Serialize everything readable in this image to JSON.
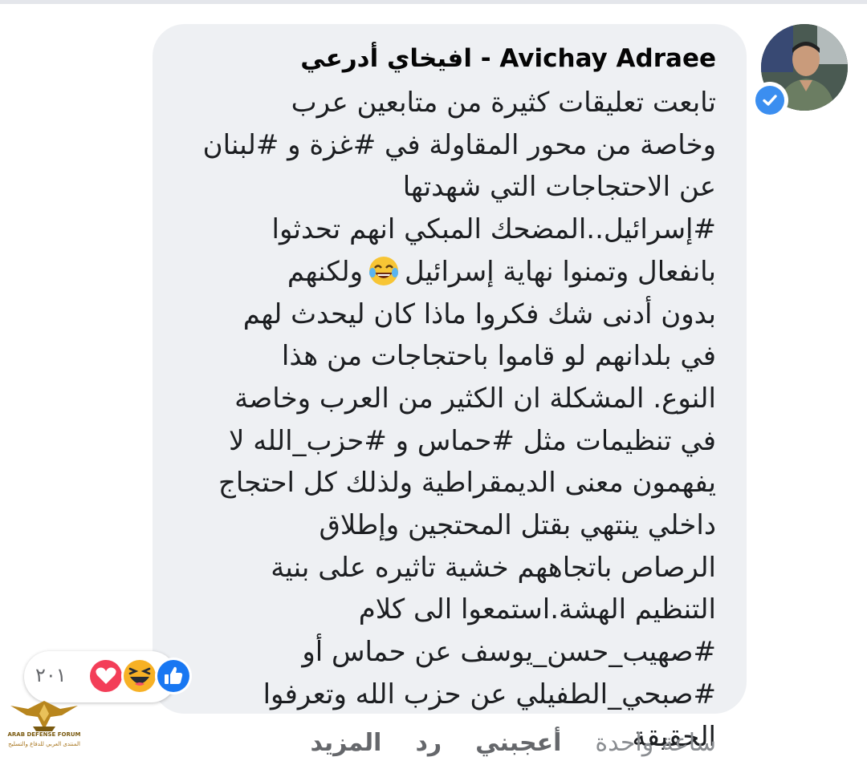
{
  "comment": {
    "author": "Avichay Adraee - افيخاي أدرعي",
    "lines": [
      "تابعت تعليقات كثيرة من متابعين عرب",
      "وخاصة من محور المقاولة في #غزة و #لبنان",
      "عن الاحتجاجات التي شهدتها",
      "#إسرائيل..المضحك المبكي انهم تحدثوا",
      "بانفعال وتمنوا نهاية إسرائيل",
      "ولكنهم",
      "بدون أدنى شك فكروا ماذا كان ليحدث لهم",
      "في بلدانهم لو قاموا باحتجاجات من هذا",
      "النوع. المشكلة ان الكثير من العرب وخاصة",
      "في تنظيمات مثل #حماس و #حزب_الله لا",
      "يفهمون معنى الديمقراطية ولذلك كل احتجاج",
      "داخلي ينتهي بقتل المحتجين وإطلاق",
      "الرصاص باتجاههم خشية تاثيره على بنية",
      "التنظيم الهشة.استمعوا الى كلام",
      "#صهيب_حسن_يوسف عن حماس أو",
      "#صبحي_الطفيلي عن حزب الله وتعرفوا",
      "الحقيقة"
    ]
  },
  "reactions": {
    "count": "٢٠١",
    "types": [
      "like-icon",
      "haha-icon",
      "love-icon"
    ]
  },
  "actions": {
    "time": "ساعة واحدة",
    "like": "أعجبني",
    "reply": "رد",
    "more": "المزيد"
  },
  "watermark": {
    "line1": "ARAB DEFENSE FORUM",
    "line2": "المنتدى العربي للدفاع والتسليح"
  },
  "colors": {
    "bubble": "#eef0f3",
    "verified": "#3b8ef0",
    "like": "#1877f2",
    "love": "#f33e58",
    "haha": "#f7b125"
  }
}
